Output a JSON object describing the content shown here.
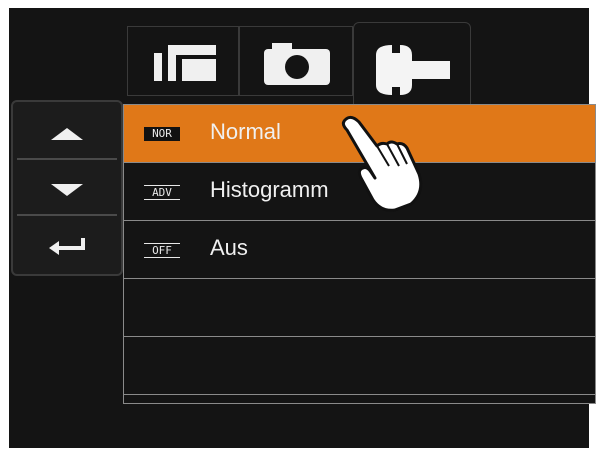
{
  "tabs": [
    {
      "id": "playback",
      "icon": "playback-icon",
      "active": false
    },
    {
      "id": "camera",
      "icon": "camera-icon",
      "active": false
    },
    {
      "id": "setup",
      "icon": "wrench-icon",
      "active": true
    }
  ],
  "nav": {
    "up_icon": "triangle-up-icon",
    "down_icon": "triangle-down-icon",
    "enter_icon": "return-arrow-icon"
  },
  "menu": {
    "items": [
      {
        "icon_text": "NOR",
        "label": "Normal",
        "selected": true
      },
      {
        "icon_text": "ADV",
        "label": "Histogramm",
        "selected": false
      },
      {
        "icon_text": "OFF",
        "label": "Aus",
        "selected": false
      },
      {
        "icon_text": "",
        "label": "",
        "selected": false
      },
      {
        "icon_text": "",
        "label": "",
        "selected": false
      }
    ]
  },
  "colors": {
    "accent": "#e07818",
    "background": "#141414",
    "text": "#f0f0f0"
  },
  "pointer": {
    "icon": "pointing-hand-icon"
  }
}
